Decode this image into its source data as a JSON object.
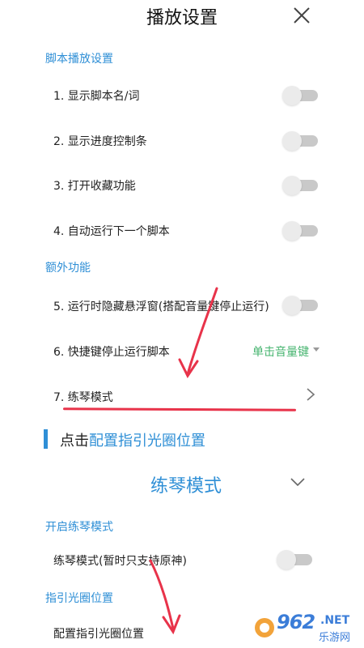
{
  "header": {
    "title": "播放设置",
    "close_icon": "close-icon"
  },
  "sections": {
    "script_play": "脚本播放设置",
    "extra": "额外功能",
    "practice_on": "开启练琴模式",
    "guide_pos": "指引光圈位置"
  },
  "rows": {
    "show_name": {
      "label": "1. 显示脚本名/词",
      "enabled": false
    },
    "show_progress": {
      "label": "2. 显示进度控制条",
      "enabled": false
    },
    "favorite": {
      "label": "3. 打开收藏功能",
      "enabled": false
    },
    "auto_next": {
      "label": "4. 自动运行下一个脚本",
      "enabled": false
    },
    "hide_float": {
      "label": "5. 运行时隐藏悬浮窗(搭配音量键停止运行)",
      "enabled": false
    },
    "hotkey_stop": {
      "label": "6. 快捷键停止运行脚本",
      "value": "单击音量键"
    },
    "practice_mode": {
      "label": "7. 练琴模式"
    },
    "practice_toggle": {
      "label": "练琴模式(暂时只支持原神)",
      "enabled": false
    },
    "config_guide": {
      "label": "配置指引光圈位置"
    }
  },
  "hint": {
    "prefix": "点击",
    "link": "配置指引光圈位置"
  },
  "practice_panel": {
    "title": "练琴模式"
  },
  "watermark": {
    "number": "962",
    "net": ".NET",
    "cn": "乐游网"
  },
  "colors": {
    "accent": "#2f8fd6",
    "green_value": "#46b46f",
    "annotation_red": "#e8334a"
  }
}
